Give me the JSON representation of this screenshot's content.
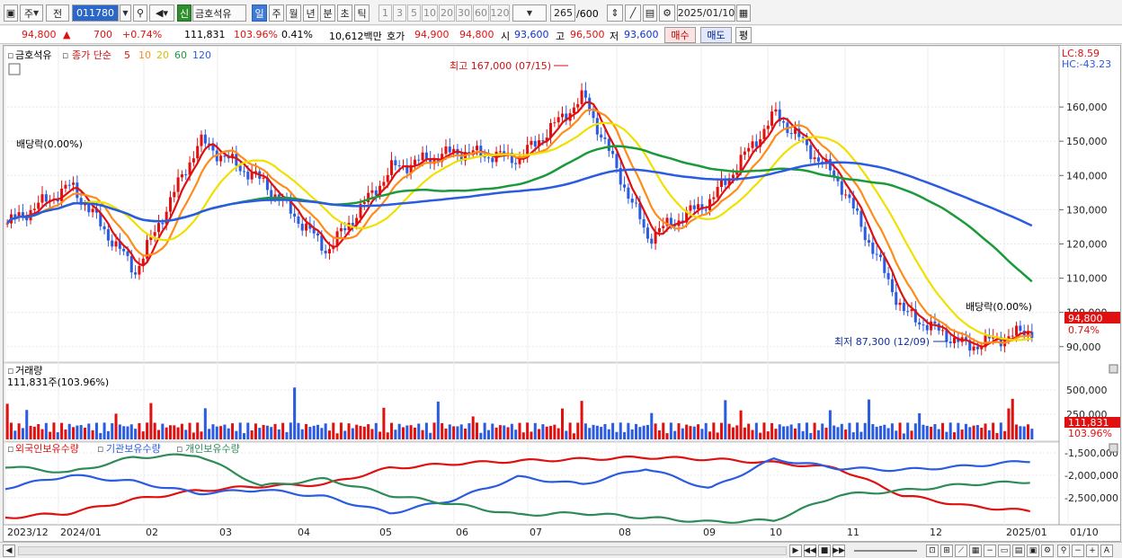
{
  "toolbar": {
    "market": "주",
    "prev": "전",
    "code": "011780",
    "badge_new": "신",
    "name": "금호석유",
    "periods": [
      "일",
      "주",
      "월",
      "년",
      "분",
      "초",
      "틱"
    ],
    "active_period": "일",
    "intervals": [
      "1",
      "3",
      "5",
      "10",
      "20",
      "30",
      "60",
      "120"
    ],
    "count": "265",
    "count_total": "/600",
    "date": "2025/01/10"
  },
  "quote": {
    "price": "94,800",
    "change_arrow": "▲",
    "change": "700",
    "change_pct": "+0.74%",
    "volume": "111,831",
    "vol_ratio": "103.96%",
    "turnover_pct": "0.41%",
    "amount": "10,612백만",
    "hoga_label": "호가",
    "hoga_ask": "94,900",
    "hoga_bid": "94,800",
    "open_label": "시",
    "open": "93,600",
    "high_label": "고",
    "high": "96,500",
    "low_label": "저",
    "low": "93,600",
    "buy_btn": "매수",
    "sell_btn": "매도",
    "eval_btn": "평"
  },
  "price_panel": {
    "stock_label": "금호석유",
    "ma_title": "종가 단순",
    "ma_periods": [
      "5",
      "10",
      "20",
      "60",
      "120"
    ],
    "ma_colors": [
      "#e01010",
      "#ff8c1a",
      "#f0e000",
      "#1a9a3a",
      "#2a5be0"
    ],
    "lc": "LC:8.59",
    "hc": "HC:-43.23",
    "high_note": "최고 167,000 (07/15)",
    "low_note": "최저 87,300 (12/09)",
    "div_note_left": "배당락(0.00%)",
    "div_note_right": "배당락(0.00%)",
    "last_price_tag": "94,800",
    "last_pct_tag": "0.74%",
    "y_ticks": [
      "160,000",
      "150,000",
      "140,000",
      "130,000",
      "120,000",
      "110,000",
      "100,000",
      "90,000"
    ]
  },
  "volume_panel": {
    "title": "거래량",
    "value": "111,831주(103.96%)",
    "y_ticks": [
      "500,000",
      "250,000"
    ],
    "last_tag": "111,831",
    "pct_tag": "103.96%"
  },
  "holding_panel": {
    "legend": [
      "외국인보유수량",
      "기관보유수량",
      "개인보유수량"
    ],
    "colors": [
      "#e01010",
      "#2a5be0",
      "#2e8b57"
    ],
    "y_ticks": [
      "-1,500,000",
      "-2,000,000",
      "-2,500,000"
    ]
  },
  "x_axis": {
    "labels": [
      "2023/12",
      "2024/01",
      "02",
      "03",
      "04",
      "05",
      "06",
      "07",
      "08",
      "09",
      "10",
      "11",
      "12",
      "2025/01",
      "01/10"
    ]
  },
  "chart_data": {
    "type": "line",
    "title": "금호석유",
    "ylim": [
      86000,
      170000
    ],
    "x": [
      "2023/12",
      "2024/01",
      "02",
      "03",
      "04",
      "05",
      "06",
      "07",
      "08",
      "09",
      "10",
      "11",
      "12",
      "2025/01"
    ],
    "series": [
      {
        "name": "종가",
        "values": [
          126000,
          137000,
          112000,
          150000,
          138000,
          118000,
          142000,
          147000,
          145000,
          163000,
          122000,
          133000,
          158000,
          138000,
          100000,
          90000,
          94800
        ]
      },
      {
        "name": "5",
        "values": [
          126000,
          136000,
          113000,
          148000,
          139000,
          119000,
          141000,
          147000,
          146000,
          162000,
          125000,
          133000,
          157000,
          139000,
          101000,
          91000,
          94000
        ]
      },
      {
        "name": "120",
        "values": [
          127000,
          127000,
          127000,
          131000,
          133000,
          135000,
          136000,
          140000,
          145000,
          143000,
          142000,
          142000,
          145000,
          140000,
          131000
        ]
      }
    ],
    "volume": {
      "max": 500000,
      "last": 111831
    }
  }
}
